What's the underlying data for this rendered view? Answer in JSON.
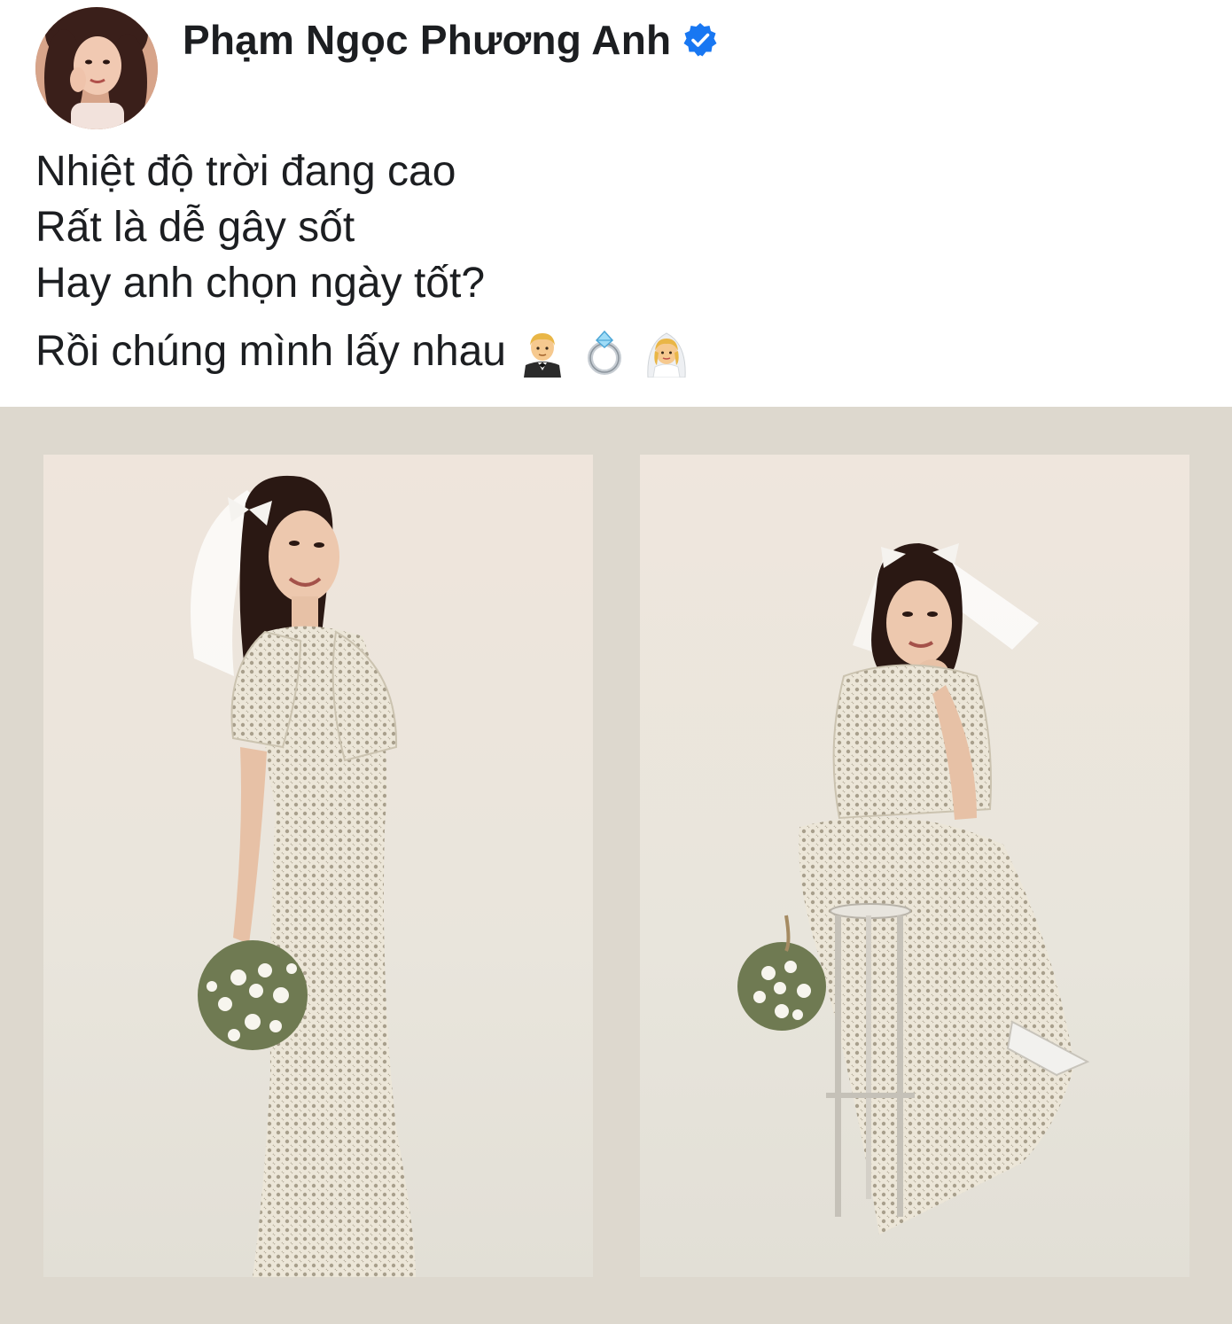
{
  "post": {
    "author": {
      "name": "Phạm Ngọc Phương Anh",
      "verified": true
    },
    "caption": {
      "lines": [
        "Nhiệt độ trời đang cao",
        "Rất là dễ gây sốt",
        "Hay anh chọn ngày tốt?",
        "Rồi chúng mình lấy nhau"
      ],
      "emojis": [
        "man-in-tuxedo-icon",
        "ring-icon",
        "bride-with-veil-icon"
      ]
    },
    "photos": [
      {
        "description": "standing-bride-photo"
      },
      {
        "description": "seated-bride-photo"
      }
    ]
  },
  "colors": {
    "gallery_bg": "#ddd8ce",
    "verified_blue": "#1877f2",
    "text": "#1c1e21"
  }
}
